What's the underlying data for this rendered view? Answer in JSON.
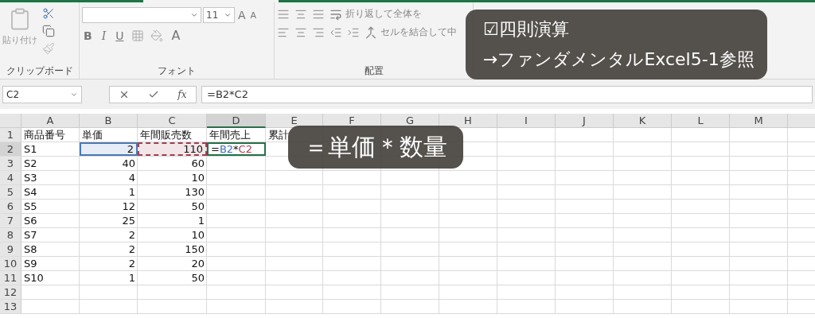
{
  "ribbon": {
    "clipboard": {
      "paste_label": "貼り付け",
      "group_label": "クリップボード"
    },
    "font": {
      "font_size": "11",
      "grow": "A",
      "shrink": "A",
      "bold": "B",
      "italic": "I",
      "underline": "U",
      "font_color": "A",
      "group_label": "フォント"
    },
    "alignment": {
      "wrap_text": "折り返して全体を",
      "merge": "セルを結合して中",
      "group_label": "配置"
    }
  },
  "formula_bar": {
    "name_box": "C2",
    "fx": "fx",
    "formula": "=B2*C2"
  },
  "columns": [
    {
      "label": "A",
      "selected": false
    },
    {
      "label": "B",
      "selected": false
    },
    {
      "label": "C",
      "selected": false
    },
    {
      "label": "D",
      "selected": true
    },
    {
      "label": "E",
      "selected": false
    },
    {
      "label": "F",
      "selected": false
    },
    {
      "label": "G",
      "selected": false
    },
    {
      "label": "H",
      "selected": false
    },
    {
      "label": "I",
      "selected": false
    },
    {
      "label": "J",
      "selected": false
    },
    {
      "label": "K",
      "selected": false
    },
    {
      "label": "L",
      "selected": false
    },
    {
      "label": "M",
      "selected": false
    }
  ],
  "rows": [
    {
      "number": "1",
      "selected": false,
      "cells": [
        {
          "kind": "text",
          "text": "商品番号"
        },
        {
          "kind": "text",
          "text": "単価"
        },
        {
          "kind": "text",
          "text": "年間販売数"
        },
        {
          "kind": "text",
          "text": "年間売上"
        },
        {
          "kind": "text",
          "text": "累計"
        }
      ]
    },
    {
      "number": "2",
      "selected": true,
      "cells": [
        {
          "kind": "text",
          "text": "S1"
        },
        {
          "kind": "number",
          "text": "2",
          "color": "#4a78b8"
        },
        {
          "kind": "number",
          "text": "110",
          "color": "#a04050"
        },
        {
          "kind": "formula",
          "editing": true,
          "parts": [
            {
              "text": "="
            },
            {
              "text": "B2",
              "color": "#3a6fb5"
            },
            {
              "text": "*"
            },
            {
              "text": "C2",
              "color": "#a04050"
            }
          ]
        }
      ]
    },
    {
      "number": "3",
      "selected": false,
      "cells": [
        {
          "kind": "text",
          "text": "S2"
        },
        {
          "kind": "number",
          "text": "40"
        },
        {
          "kind": "number",
          "text": "60"
        }
      ]
    },
    {
      "number": "4",
      "selected": false,
      "cells": [
        {
          "kind": "text",
          "text": "S3"
        },
        {
          "kind": "number",
          "text": "4"
        },
        {
          "kind": "number",
          "text": "10"
        }
      ]
    },
    {
      "number": "5",
      "selected": false,
      "cells": [
        {
          "kind": "text",
          "text": "S4"
        },
        {
          "kind": "number",
          "text": "1"
        },
        {
          "kind": "number",
          "text": "130"
        }
      ]
    },
    {
      "number": "6",
      "selected": false,
      "cells": [
        {
          "kind": "text",
          "text": "S5"
        },
        {
          "kind": "number",
          "text": "12"
        },
        {
          "kind": "number",
          "text": "50"
        }
      ]
    },
    {
      "number": "7",
      "selected": false,
      "cells": [
        {
          "kind": "text",
          "text": "S6"
        },
        {
          "kind": "number",
          "text": "25"
        },
        {
          "kind": "number",
          "text": "1"
        }
      ]
    },
    {
      "number": "8",
      "selected": false,
      "cells": [
        {
          "kind": "text",
          "text": "S7"
        },
        {
          "kind": "number",
          "text": "2"
        },
        {
          "kind": "number",
          "text": "10"
        }
      ]
    },
    {
      "number": "9",
      "selected": false,
      "cells": [
        {
          "kind": "text",
          "text": "S8"
        },
        {
          "kind": "number",
          "text": "2"
        },
        {
          "kind": "number",
          "text": "150"
        }
      ]
    },
    {
      "number": "10",
      "selected": false,
      "cells": [
        {
          "kind": "text",
          "text": "S9"
        },
        {
          "kind": "number",
          "text": "2"
        },
        {
          "kind": "number",
          "text": "20"
        }
      ]
    },
    {
      "number": "11",
      "selected": false,
      "cells": [
        {
          "kind": "text",
          "text": "S10"
        },
        {
          "kind": "number",
          "text": "1"
        },
        {
          "kind": "number",
          "text": "50"
        }
      ]
    },
    {
      "number": "12",
      "selected": false,
      "cells": []
    },
    {
      "number": "13",
      "selected": false,
      "cells": []
    }
  ],
  "captions": [
    {
      "kind": "topic",
      "lines": [
        "☑四則演算",
        "→ファンダメンタルExcel5-1参照"
      ]
    },
    {
      "kind": "formula",
      "lines": [
        "＝単価＊数量"
      ]
    }
  ]
}
